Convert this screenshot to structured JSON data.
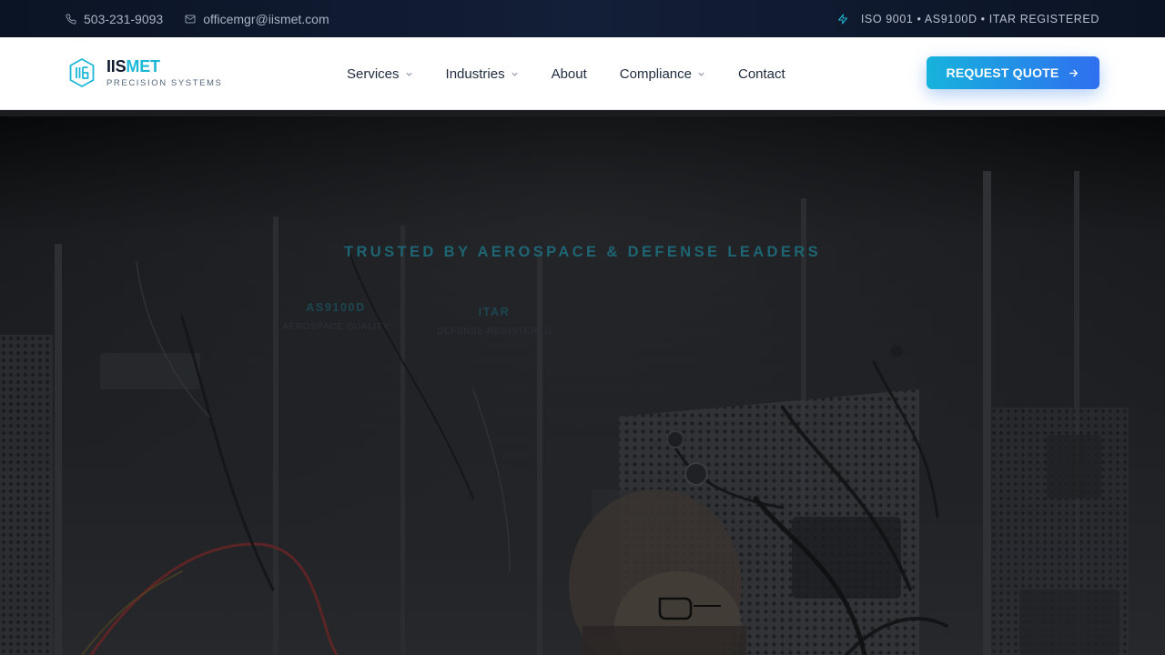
{
  "topbar": {
    "phone": "503-231-9093",
    "email": "officemgr@iismet.com",
    "certifications": "ISO 9001 • AS9100D • ITAR REGISTERED",
    "phone_icon": "phone-icon",
    "email_icon": "mail-icon",
    "cert_icon": "lightning-icon"
  },
  "brand": {
    "name_part1": "IIS",
    "name_part2": "MET",
    "tagline": "PRECISION SYSTEMS",
    "accent_color": "#1db8d8",
    "dark_color": "#0f1a2e"
  },
  "nav": {
    "items": [
      {
        "label": "Services",
        "has_dropdown": true
      },
      {
        "label": "Industries",
        "has_dropdown": true
      },
      {
        "label": "About",
        "has_dropdown": false
      },
      {
        "label": "Compliance",
        "has_dropdown": true
      },
      {
        "label": "Contact",
        "has_dropdown": false
      }
    ],
    "cta_label": "REQUEST QUOTE",
    "cta_icon": "arrow-right-icon"
  },
  "hero": {
    "tagline": "TRUSTED BY AEROSPACE & DEFENSE LEADERS",
    "certs": [
      {
        "title": "AS9100D",
        "subtitle": "AEROSPACE QUALITY"
      },
      {
        "title": "ITAR",
        "subtitle": "DEFENSE REGISTERED"
      }
    ]
  }
}
